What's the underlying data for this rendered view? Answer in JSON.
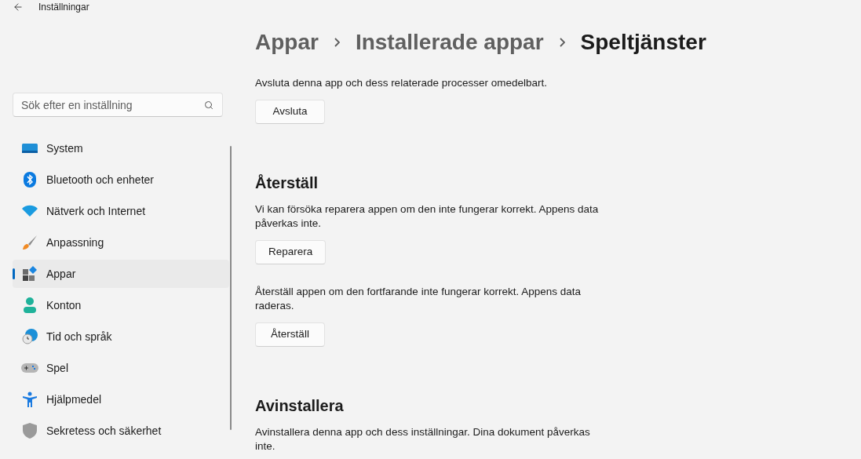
{
  "window": {
    "title": "Inställningar"
  },
  "search": {
    "placeholder": "Sök efter en inställning"
  },
  "nav": [
    {
      "label": "System",
      "selected": false
    },
    {
      "label": "Bluetooth och enheter",
      "selected": false
    },
    {
      "label": "Nätverk och Internet",
      "selected": false
    },
    {
      "label": "Anpassning",
      "selected": false
    },
    {
      "label": "Appar",
      "selected": true
    },
    {
      "label": "Konton",
      "selected": false
    },
    {
      "label": "Tid och språk",
      "selected": false
    },
    {
      "label": "Spel",
      "selected": false
    },
    {
      "label": "Hjälpmedel",
      "selected": false
    },
    {
      "label": "Sekretess och säkerhet",
      "selected": false
    }
  ],
  "breadcrumb": [
    "Appar",
    "Installerade appar",
    "Speltjänster"
  ],
  "content": [
    {
      "kind": "text",
      "text": "Avsluta denna app och dess relaterade processer omedelbart."
    },
    {
      "kind": "button",
      "text": "Avsluta"
    },
    {
      "kind": "heading",
      "text": "Återställ"
    },
    {
      "kind": "text",
      "text": "Vi kan försöka reparera appen om den inte fungerar korrekt. Appens data påverkas inte."
    },
    {
      "kind": "button",
      "text": "Reparera"
    },
    {
      "kind": "text",
      "text": "Återställ appen om den fortfarande inte fungerar korrekt. Appens data raderas."
    },
    {
      "kind": "button",
      "text": "Återställ"
    },
    {
      "kind": "heading",
      "text": "Avinstallera"
    },
    {
      "kind": "text",
      "text": "Avinstallera denna app och dess inställningar. Dina dokument påverkas inte."
    }
  ]
}
